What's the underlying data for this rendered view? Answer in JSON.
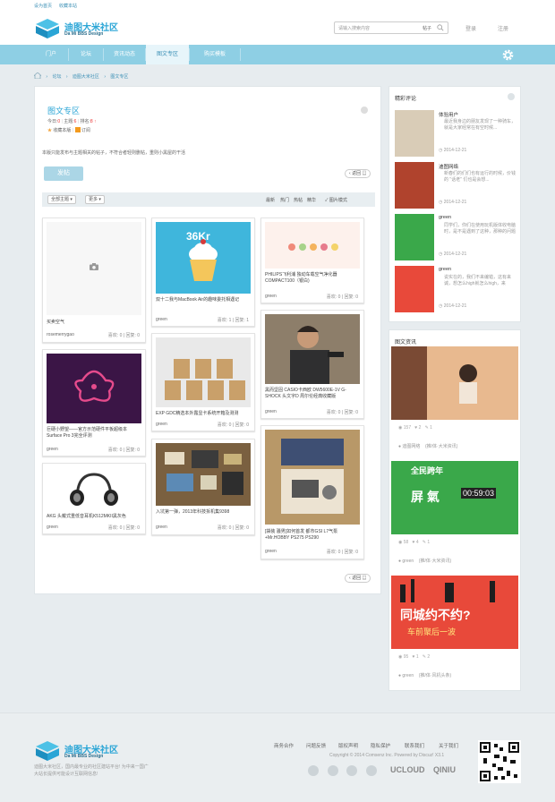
{
  "topbar": {
    "left1": "设为首页",
    "left2": "收藏本站"
  },
  "header": {
    "logo_cn": "迪图大米社区",
    "logo_en": "Da Mi BBS Design",
    "search_placeholder": "请输入搜索内容",
    "search_category": "帖子",
    "login": "登录",
    "register": "注册"
  },
  "nav": {
    "items": [
      "门户",
      "论坛",
      "资讯动态",
      "图文专区",
      "购买模板"
    ],
    "active_index": 3
  },
  "breadcrumb": [
    "论坛",
    "迪图大米社区",
    "图文专区"
  ],
  "forum": {
    "title": "图文专区",
    "stats": {
      "today_label": "今日:",
      "today": "0",
      "topics_label": "主题:",
      "topics": "6",
      "rank_label": "排名:",
      "rank": "8"
    },
    "fav": "收藏本版",
    "rss": "订阅",
    "description": "本版只能发布与主题相关的帖子，不符合者轻则删帖，重则小黑屋的干活",
    "post_button": "发帖",
    "back_button": "返回"
  },
  "filters": {
    "sel1": "全部主题",
    "sel2": "更多",
    "links": [
      "最新",
      "热门",
      "热帖",
      "精华"
    ],
    "pic_mode": "图片模式"
  },
  "cards": [
    {
      "title": "买卖空气",
      "author": "rosemerrygao",
      "likes_label": "喜欢:",
      "likes": "0",
      "replies_label": "回复:",
      "replies": "0"
    },
    {
      "title": "双十二我与MacBook Air的趣味委托相遇记",
      "author": "green",
      "likes_label": "喜欢:",
      "likes": "1",
      "replies_label": "回复:",
      "replies": "1"
    },
    {
      "title": "PHILIPS飞利浦 独动车载空气净化器 COMPACT100（银白)",
      "author": "green",
      "likes_label": "喜欢:",
      "likes": "0",
      "replies_label": "回复:",
      "replies": "0"
    },
    {
      "title": "巨硬小野望——官方示范硬件平板超级本 Surface Pro 3完全评测",
      "author": "green",
      "likes_label": "喜欢:",
      "likes": "0",
      "replies_label": "回复:",
      "replies": "0"
    },
    {
      "title": "EXP GDC精选本外露显卡系统开箱及测测",
      "author": "green",
      "likes_label": "喜欢:",
      "likes": "0",
      "replies_label": "回复:",
      "replies": "0"
    },
    {
      "title": "黑而坚固 CASIO卡西欧 DW5600E-1V G-SHOCK 头文字D 周尔伦经典收藏版",
      "author": "green",
      "likes_label": "喜欢:",
      "likes": "0",
      "replies_label": "回复:",
      "replies": "0"
    },
    {
      "title": "AKG 头戴式重低音耳机K512MKII黑灰色",
      "author": "green",
      "likes_label": "喜欢:",
      "likes": "0",
      "replies_label": "回复:",
      "replies": "0"
    },
    {
      "title": "入坑第一弹，2013年科技拆机集9398",
      "author": "green",
      "likes_label": "喜欢:",
      "likes": "0",
      "replies_label": "回复:",
      "replies": "0"
    },
    {
      "title": "[袋装 骚男]如何首发 都市GSI L7气泵+Mr.HOBBY PS275 PS290",
      "author": "green",
      "likes_label": "喜欢:",
      "likes": "0",
      "replies_label": "回复:",
      "replies": "0"
    }
  ],
  "hot_comments": {
    "title": "精彩评论",
    "items": [
      {
        "name": "体验用户",
        "text": "最近我身边的朋友发现了一种骑车，就是大家经常在有空时候...",
        "date": "2014-12-21"
      },
      {
        "name": "迪图网络",
        "text": "新春们的们们也有运行的时候，价钱的 \"话老\" 们也是会想...",
        "date": "2014-12-21"
      },
      {
        "name": "green",
        "text": "同学们，你们在使用玩机版体收电脑时，是不是遇到了这种，那种的问题",
        "date": "2014-12-21"
      },
      {
        "name": "green",
        "text": "说实在的，我们不来编错，这有来诚，想怎么high就怎么high，来",
        "date": "2014-12-21"
      }
    ]
  },
  "pic_news": {
    "title": "图文资讯",
    "items": [
      {
        "views": "157",
        "likes": "2",
        "comments": "1",
        "user": "迪图网络",
        "note": "(推/体·大米资讯)"
      },
      {
        "views": "58",
        "likes": "4",
        "comments": "1",
        "user": "green",
        "note": "(推/体·大米资讯)",
        "poster_line1": "全民跨年",
        "poster_line2": "屏 氣",
        "poster_count": "00:59:03"
      },
      {
        "views": "95",
        "likes": "1",
        "comments": "2",
        "user": "green",
        "note": "(推/体·风机头条)",
        "poster_line1": "同城约不约?",
        "poster_line2": "车前聚后一波"
      }
    ]
  },
  "footer": {
    "links": [
      "商务合作",
      "问题反馈",
      "版权声明",
      "隐私保护",
      "联系我们",
      "关于我们"
    ],
    "copyright": "Copyright © 2014 Comsenz Inc. Powered by Discuz! X3.1",
    "desc": "迪图大米社区，国内最专业的社区建站平台! 为中来一国广大站长提供可能设计互联网信息!",
    "partners": [
      "UCLOUD",
      "QINIU"
    ]
  },
  "colors": {
    "accent": "#2aa5d6",
    "nav": "#8ecfe4",
    "bg": "#e7ecef"
  }
}
